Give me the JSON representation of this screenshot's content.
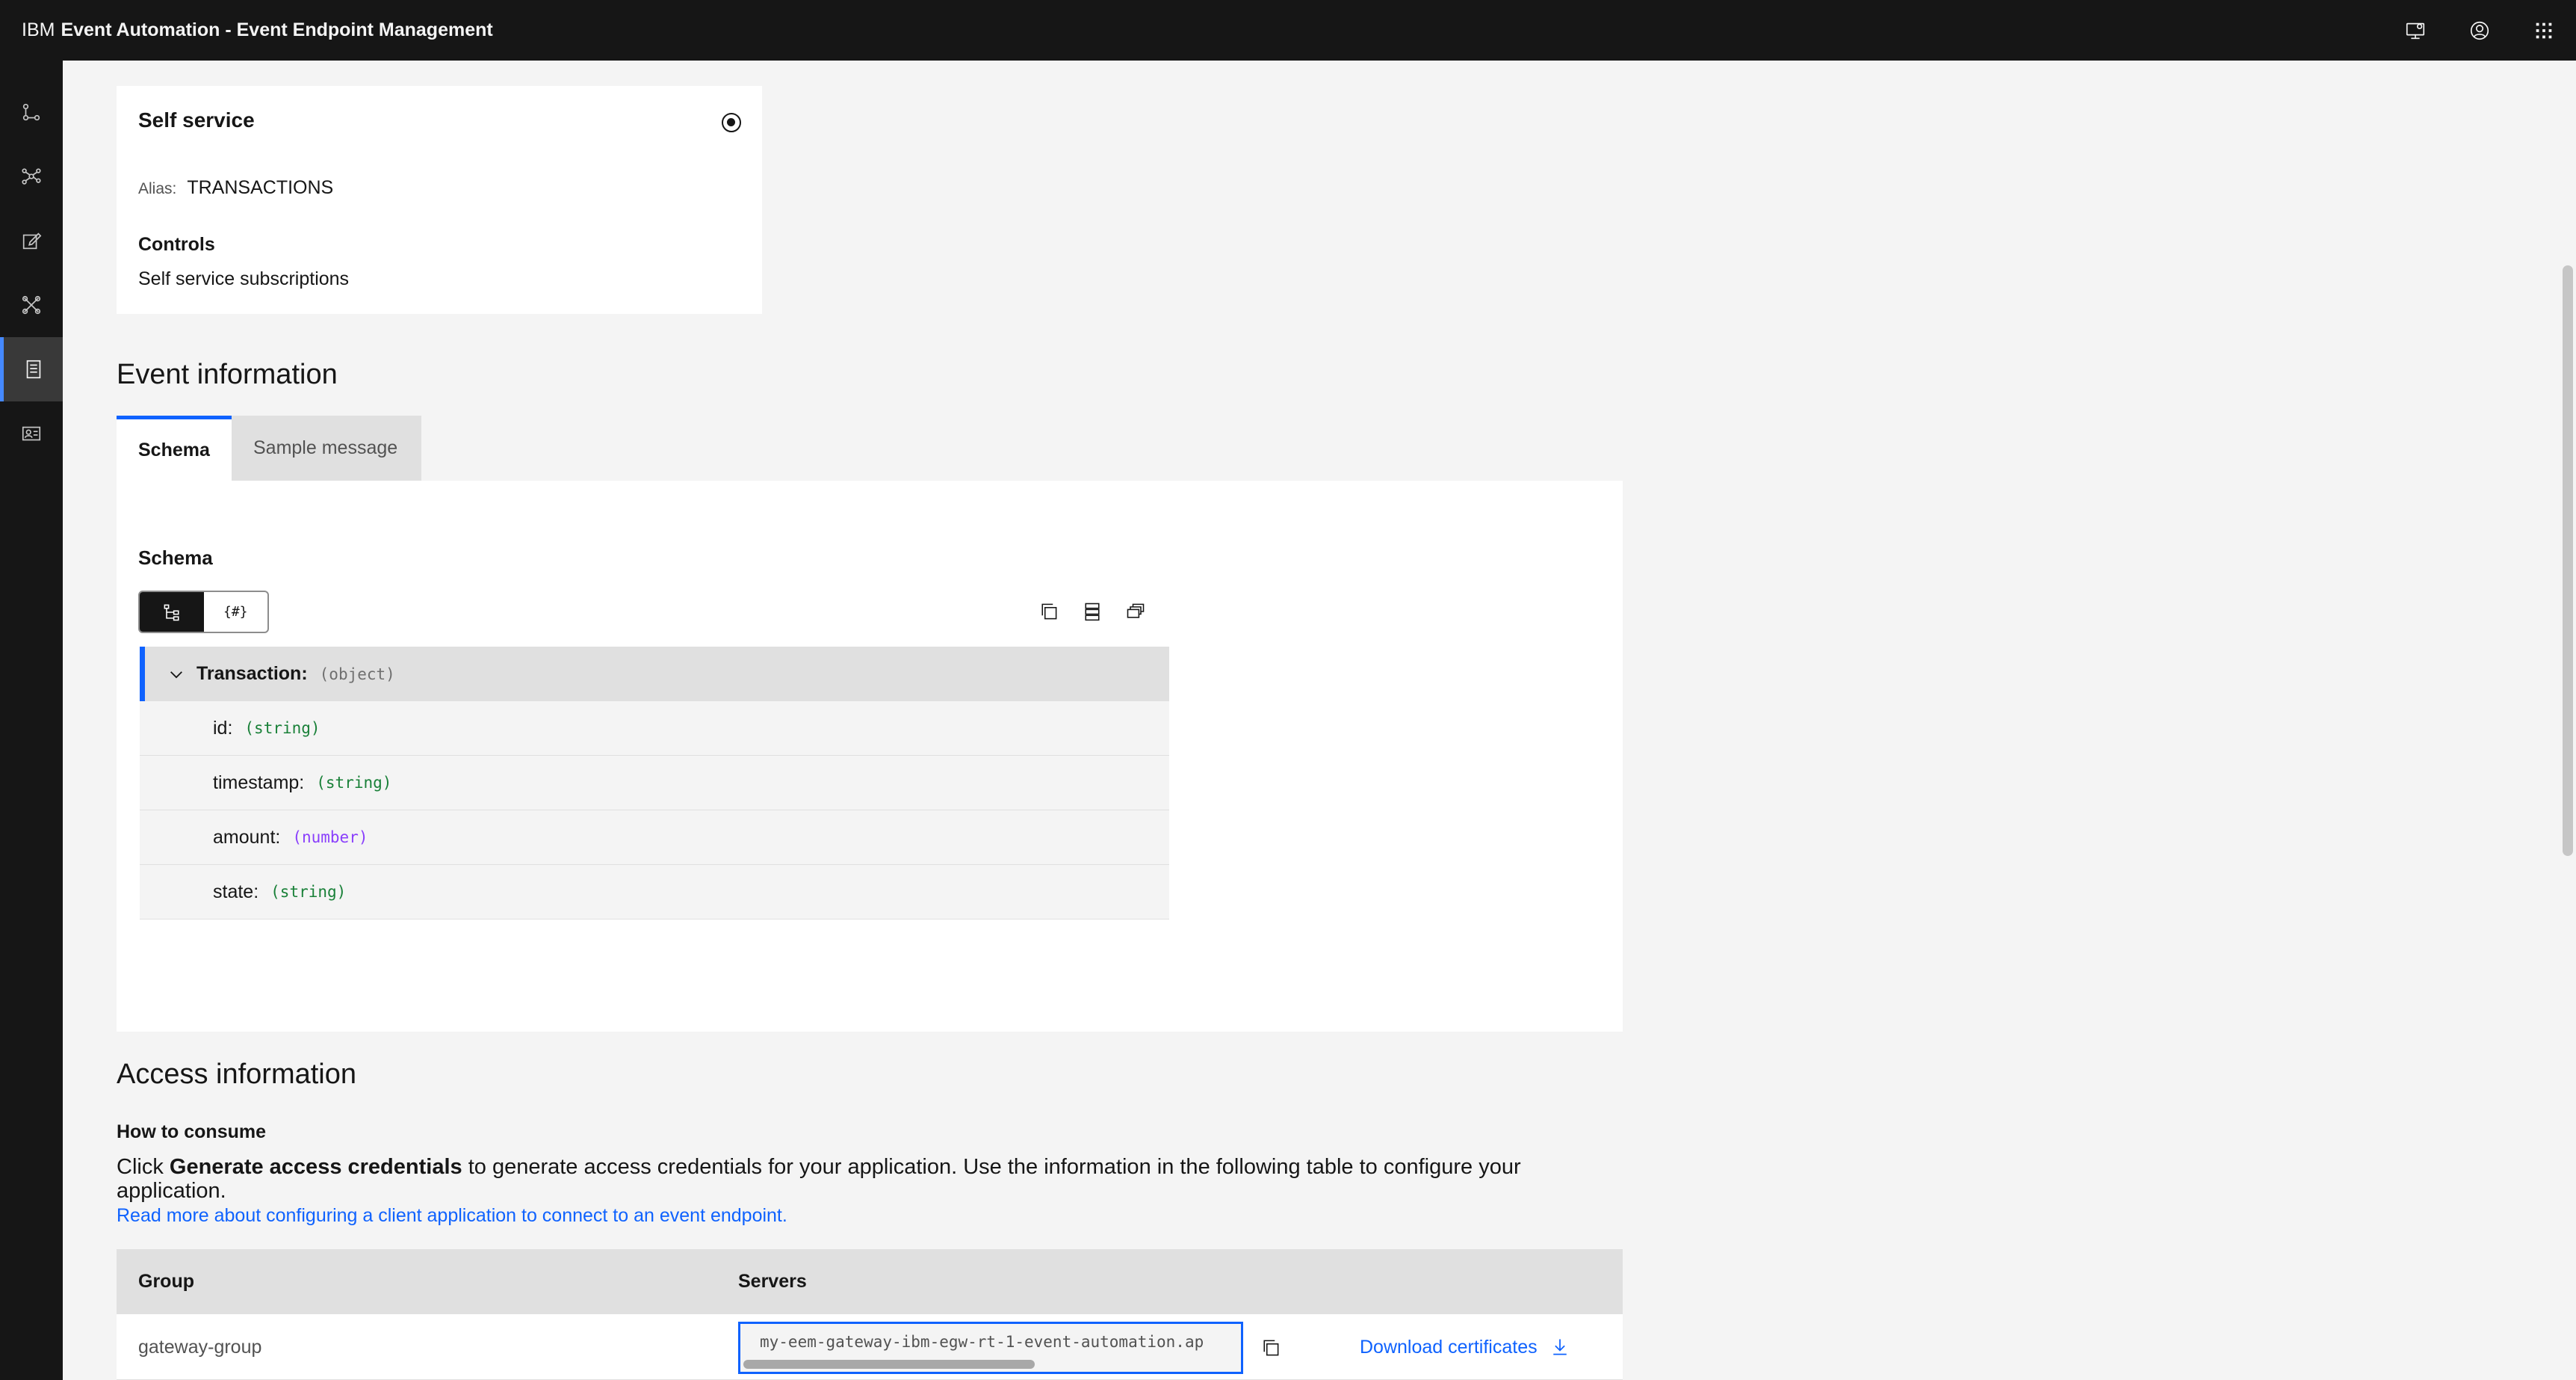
{
  "header": {
    "brand_ibm": "IBM",
    "brand_product": "Event Automation - Event Endpoint Management",
    "icons": [
      "notification-monitor-icon",
      "user-avatar-icon",
      "app-switcher-icon"
    ]
  },
  "sidenav": {
    "items": [
      {
        "icon": "topology-icon",
        "active": false
      },
      {
        "icon": "network-icon",
        "active": false
      },
      {
        "icon": "edit-icon",
        "active": false
      },
      {
        "icon": "tools-icon",
        "active": false
      },
      {
        "icon": "catalog-icon",
        "active": true
      },
      {
        "icon": "id-card-icon",
        "active": false
      }
    ]
  },
  "self_service": {
    "title": "Self service",
    "alias_label": "Alias:",
    "alias_value": "TRANSACTIONS",
    "controls_title": "Controls",
    "controls_value": "Self service subscriptions"
  },
  "event_info": {
    "title": "Event information",
    "tabs": [
      {
        "label": "Schema",
        "selected": true
      },
      {
        "label": "Sample message",
        "selected": false
      }
    ],
    "schema": {
      "heading": "Schema",
      "switcher_code_label": "{#}",
      "root": {
        "name": "Transaction:",
        "type": "(object)"
      },
      "fields": [
        {
          "name": "id:",
          "type": "(string)",
          "kind": "string"
        },
        {
          "name": "timestamp:",
          "type": "(string)",
          "kind": "string"
        },
        {
          "name": "amount:",
          "type": "(number)",
          "kind": "number"
        },
        {
          "name": "state:",
          "type": "(string)",
          "kind": "string"
        }
      ]
    }
  },
  "access_info": {
    "title": "Access information",
    "subhead": "How to consume",
    "para_prefix": "Click ",
    "para_bold": "Generate access credentials",
    "para_suffix": " to generate access credentials for your application. Use the information in the following table to configure your application.",
    "link": "Read more about configuring a client application to connect to an event endpoint.",
    "table": {
      "headers": [
        "Group",
        "Servers"
      ],
      "rows": [
        {
          "group": "gateway-group",
          "server": "my-eem-gateway-ibm-egw-rt-1-event-automation.ap",
          "download": "Download certificates"
        }
      ]
    }
  },
  "colors": {
    "accent": "#0f62fe",
    "header_bg": "#161616",
    "string_type": "#198038",
    "number_type": "#8a3ffc"
  }
}
